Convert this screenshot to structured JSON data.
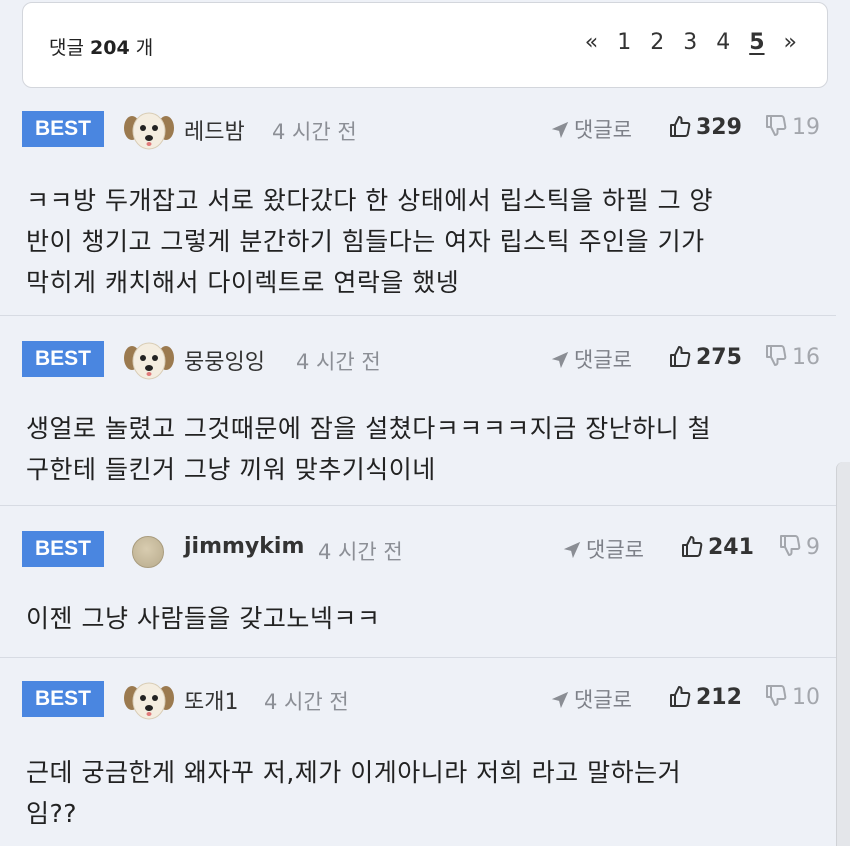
{
  "header": {
    "count_label": "댓글",
    "count": "204",
    "count_unit": "개",
    "pager": {
      "prev": "«",
      "pages": [
        "1",
        "2",
        "3",
        "4",
        "5"
      ],
      "current": "5",
      "next": "»"
    }
  },
  "comments": [
    {
      "badge": "BEST",
      "nick": "레드밤",
      "time": "4 시간 전",
      "reply": "댓글로",
      "likes": "329",
      "dislikes": "19",
      "lines": [
        "ㅋㅋ방 두개잡고 서로 왔다갔다 한 상태에서 립스틱을 하필 그 양",
        "반이 챙기고 그렇게 분간하기 힘들다는 여자 립스틱 주인을 기가",
        "막히게 캐치해서 다이렉트로 연락을 했넹"
      ]
    },
    {
      "badge": "BEST",
      "nick": "뭉뭉잉잉",
      "time": "4 시간 전",
      "reply": "댓글로",
      "likes": "275",
      "dislikes": "16",
      "lines": [
        "생얼로 놀렸고 그것때문에 잠을 설쳤다ㅋㅋㅋㅋ지금 장난하니 철",
        "구한테 들킨거 그냥 끼워 맞추기식이네"
      ]
    },
    {
      "badge": "BEST",
      "nick": "jimmykim",
      "time": "4 시간 전",
      "reply": "댓글로",
      "likes": "241",
      "dislikes": "9",
      "lines": [
        "이젠 그냥 사람들을 갖고노넥ㅋㅋ"
      ]
    },
    {
      "badge": "BEST",
      "nick": "또개1",
      "time": "4 시간 전",
      "reply": "댓글로",
      "likes": "212",
      "dislikes": "10",
      "lines": [
        "근데 궁금한게 왜자꾸 저,제가 이게아니라 저희 라고 말하는거",
        "임??"
      ]
    }
  ],
  "icons": {
    "avatar": "puppy-avatar-icon",
    "reply": "reply-arrow-icon",
    "like": "thumbs-up-icon",
    "dislike": "thumbs-down-icon"
  },
  "colors": {
    "best_badge": "#4a86e0",
    "background": "#eef1f7"
  }
}
